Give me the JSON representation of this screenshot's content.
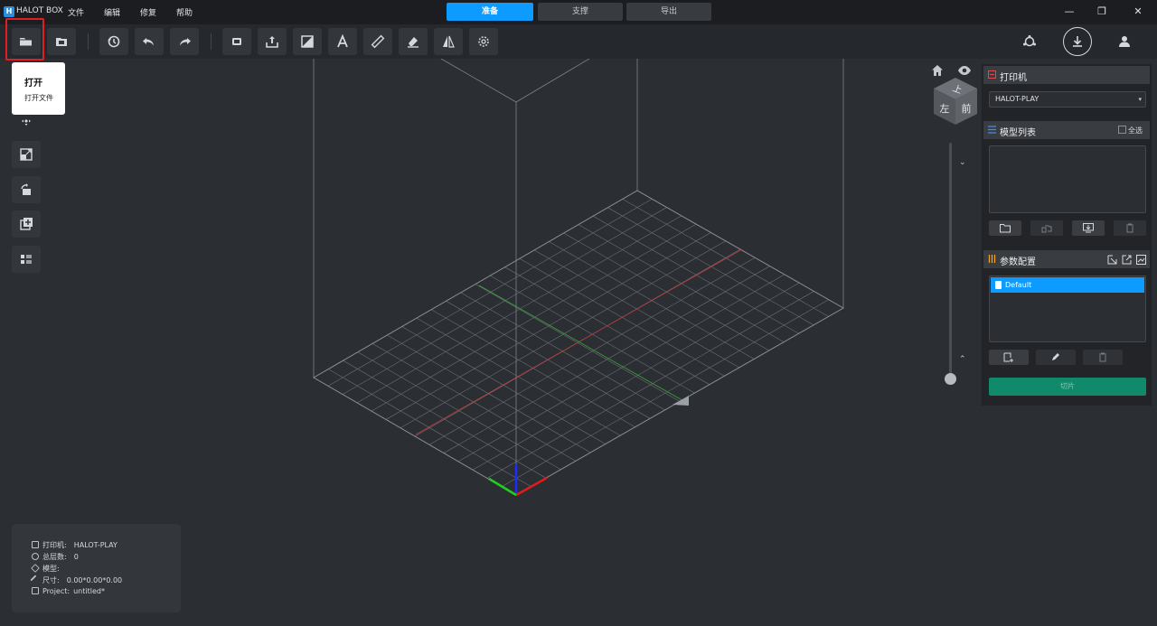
{
  "app": {
    "name": "HALOT BOX",
    "logo_letter": "H"
  },
  "menu": [
    "文件",
    "编辑",
    "修复",
    "帮助"
  ],
  "mode_tabs": [
    {
      "label": "准备",
      "active": true
    },
    {
      "label": "支撑",
      "active": false
    },
    {
      "label": "导出",
      "active": false
    }
  ],
  "window_controls": {
    "minimize": "—",
    "restore": "❐",
    "close": "✕"
  },
  "toolbar_icons": [
    "open-file-icon",
    "save-file-icon",
    "history-icon",
    "undo-icon",
    "redo-icon",
    "print-bed-icon",
    "export-icon",
    "slice-view-icon",
    "text-icon",
    "ruler-icon",
    "eraser-icon",
    "mirror-icon",
    "settings-gear-icon"
  ],
  "right_tools": [
    "network-icon",
    "download-icon",
    "user-icon"
  ],
  "tooltip": {
    "title": "打开",
    "description": "打开文件"
  },
  "left_tools": [
    "move-icon",
    "scale-icon",
    "rotate-icon",
    "add-copy-icon",
    "list-icon"
  ],
  "view_cube": {
    "top": "上",
    "left": "左",
    "front": "前"
  },
  "printer_panel": {
    "title": "打印机",
    "selected_printer": "HALOT-PLAY"
  },
  "model_panel": {
    "title": "模型列表",
    "select_all": "全选"
  },
  "param_panel": {
    "title": "参数配置",
    "items": [
      "Default"
    ]
  },
  "slice_button": "切片",
  "info": {
    "printer_label": "打印机:",
    "printer_value": "HALOT-PLAY",
    "layers_label": "总层数:",
    "layers_value": "0",
    "model_label": "模型:",
    "model_value": "",
    "size_label": "尺寸:",
    "size_value": "0.00*0.00*0.00",
    "project_label": "Project:",
    "project_value": "untitled*"
  },
  "colors": {
    "accent": "#0e9bff",
    "slice": "#108a6b",
    "highlight": "#e02020"
  }
}
